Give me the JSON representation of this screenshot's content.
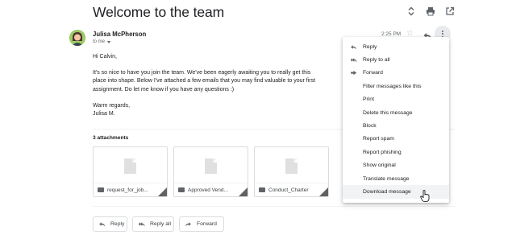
{
  "email": {
    "subject": "Welcome to the team",
    "sender": "Julisa McPherson",
    "to_label": "to me",
    "time": "2:25 PM",
    "greeting": "Hi Calvin,",
    "para1_line1": "It's so nice to have you join the team. We've been eagerly awaiting you to really get this",
    "para1_line2": "place into shape. Below I've attached a few emails that you may find valuable to your first",
    "para1_line3": "assignment. Do let me know if you have any questions :)",
    "signoff1": "Warm regards,",
    "signoff2": "Julisa M."
  },
  "attachments": {
    "title": "3 attachments",
    "items": [
      {
        "name": "request_for_job..."
      },
      {
        "name": "Approved Vend..."
      },
      {
        "name": "Conduct_Charter"
      }
    ]
  },
  "actions": {
    "reply": "Reply",
    "reply_all": "Reply all",
    "forward": "Forward"
  },
  "menu": {
    "items": [
      {
        "label": "Reply",
        "icon": "reply-icon"
      },
      {
        "label": "Reply to all",
        "icon": "reply-all-icon"
      },
      {
        "label": "Forward",
        "icon": "forward-icon"
      },
      {
        "label": "Filter messages like this"
      },
      {
        "label": "Print"
      },
      {
        "label": "Delete this message"
      },
      {
        "label": "Block"
      },
      {
        "label": "Report spam"
      },
      {
        "label": "Report phishing"
      },
      {
        "label": "Show original"
      },
      {
        "label": "Translate message"
      },
      {
        "label": "Download message"
      }
    ],
    "highlighted": "Download message"
  },
  "colors": {
    "avatar_bg": "#7cb342",
    "icon": "#5f6368",
    "menu_hover": "#f1f3f4"
  }
}
